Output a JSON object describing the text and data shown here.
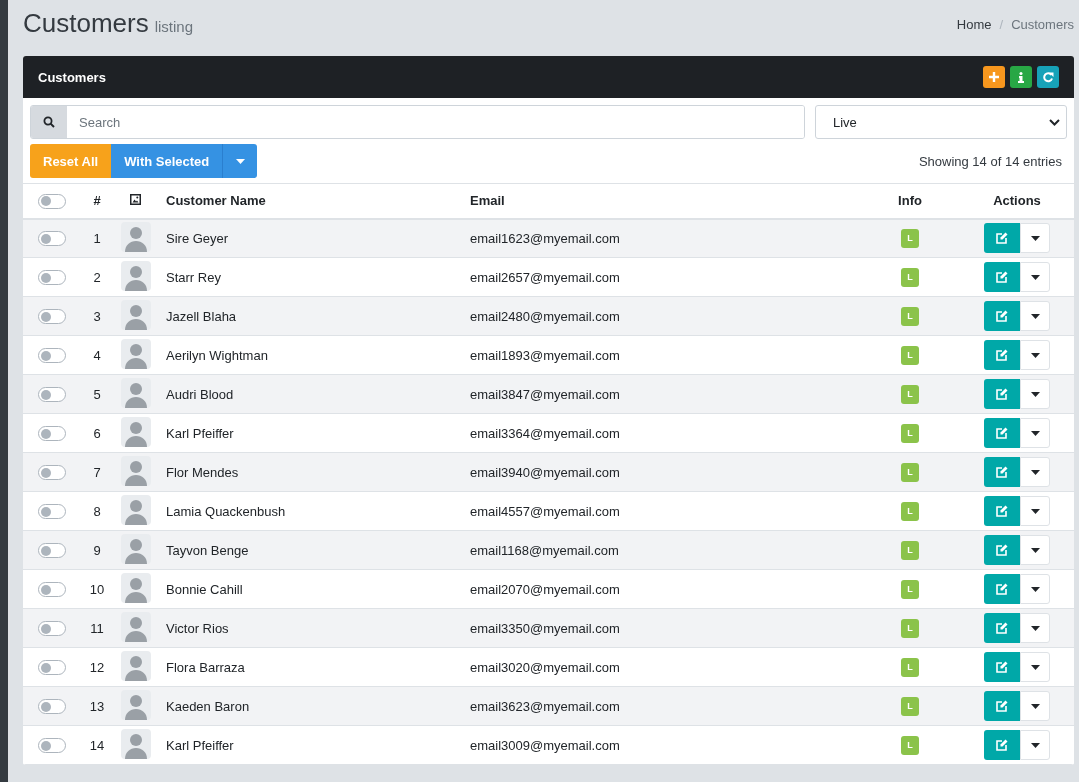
{
  "page": {
    "title": "Customers",
    "subtitle": "listing"
  },
  "breadcrumb": [
    {
      "label": "Home",
      "selected": false
    },
    {
      "label": "Customers",
      "selected": true
    }
  ],
  "breadcrumb_separator": "/",
  "card": {
    "title": "Customers",
    "tools": [
      {
        "kind": "add",
        "color": "#f7971e"
      },
      {
        "kind": "info",
        "color": "#28a745"
      },
      {
        "kind": "refresh",
        "color": "#17a2b8"
      }
    ]
  },
  "search": {
    "placeholder": "Search"
  },
  "status_filter": {
    "value": "Live"
  },
  "buttons": {
    "reset": "Reset All",
    "with_selected": "With Selected"
  },
  "summary": "Showing 14 of 14 entries",
  "table": {
    "select_all": {
      "checked": false
    },
    "columns": [
      "#",
      "Customer Name",
      "Email",
      "Info",
      "Actions"
    ],
    "rows": [
      {
        "checked": false,
        "number": "1",
        "name": "Sire Geyer",
        "email": "email1623@myemail.com",
        "info": "L"
      },
      {
        "checked": false,
        "number": "2",
        "name": "Starr Rey",
        "email": "email2657@myemail.com",
        "info": "L"
      },
      {
        "checked": false,
        "number": "3",
        "name": "Jazell Blaha",
        "email": "email2480@myemail.com",
        "info": "L"
      },
      {
        "checked": false,
        "number": "4",
        "name": "Aerilyn Wightman",
        "email": "email1893@myemail.com",
        "info": "L"
      },
      {
        "checked": false,
        "number": "5",
        "name": "Audri Blood",
        "email": "email3847@myemail.com",
        "info": "L"
      },
      {
        "checked": false,
        "number": "6",
        "name": "Karl Pfeiffer",
        "email": "email3364@myemail.com",
        "info": "L"
      },
      {
        "checked": false,
        "number": "7",
        "name": "Flor Mendes",
        "email": "email3940@myemail.com",
        "info": "L"
      },
      {
        "checked": false,
        "number": "8",
        "name": "Lamia Quackenbush",
        "email": "email4557@myemail.com",
        "info": "L"
      },
      {
        "checked": false,
        "number": "9",
        "name": "Tayvon Benge",
        "email": "email1168@myemail.com",
        "info": "L"
      },
      {
        "checked": false,
        "number": "10",
        "name": "Bonnie Cahill",
        "email": "email2070@myemail.com",
        "info": "L"
      },
      {
        "checked": false,
        "number": "11",
        "name": "Victor Rios",
        "email": "email3350@myemail.com",
        "info": "L"
      },
      {
        "checked": false,
        "number": "12",
        "name": "Flora Barraza",
        "email": "email3020@myemail.com",
        "info": "L"
      },
      {
        "checked": false,
        "number": "13",
        "name": "Kaeden Baron",
        "email": "email3623@myemail.com",
        "info": "L"
      },
      {
        "checked": false,
        "number": "14",
        "name": "Karl Pfeiffer",
        "email": "email3009@myemail.com",
        "info": "L"
      }
    ]
  }
}
